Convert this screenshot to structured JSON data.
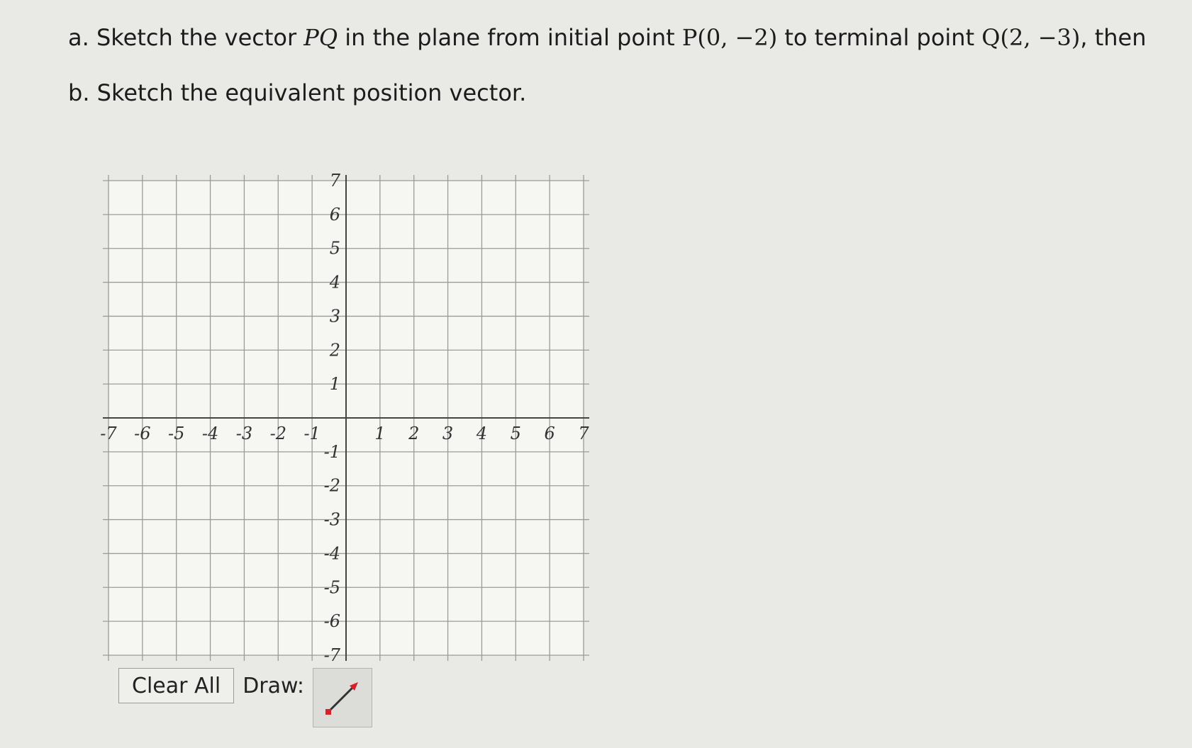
{
  "question": {
    "part_a": {
      "prefix": "a. Sketch the vector ",
      "vector": "PQ",
      "mid1": " in the plane from initial point ",
      "point_p": "P(0, −2)",
      "mid2": " to terminal point ",
      "point_q": "Q(2, −3)",
      "suffix": ", then"
    },
    "part_b": "b. Sketch the equivalent position vector."
  },
  "graph": {
    "x_min": -7,
    "x_max": 7,
    "y_min": -7,
    "y_max": 7,
    "x_tick_labels": [
      "-7",
      "-6",
      "-5",
      "-4",
      "-3",
      "-2",
      "-1",
      "1",
      "2",
      "3",
      "4",
      "5",
      "6",
      "7"
    ],
    "y_tick_labels": [
      "7",
      "6",
      "5",
      "4",
      "3",
      "2",
      "1",
      "-1",
      "-2",
      "-3",
      "-4",
      "-5",
      "-6",
      "-7"
    ],
    "grid": true,
    "colors": {
      "grid": "#9b9b9b",
      "axis": "#444444",
      "background": "#f6f6f3"
    }
  },
  "toolbar": {
    "clear_label": "Clear All",
    "draw_label": "Draw:",
    "tool_icon": "vector-arrow-icon",
    "colors": {
      "arrow": "#d8202a",
      "line": "#333333"
    }
  }
}
